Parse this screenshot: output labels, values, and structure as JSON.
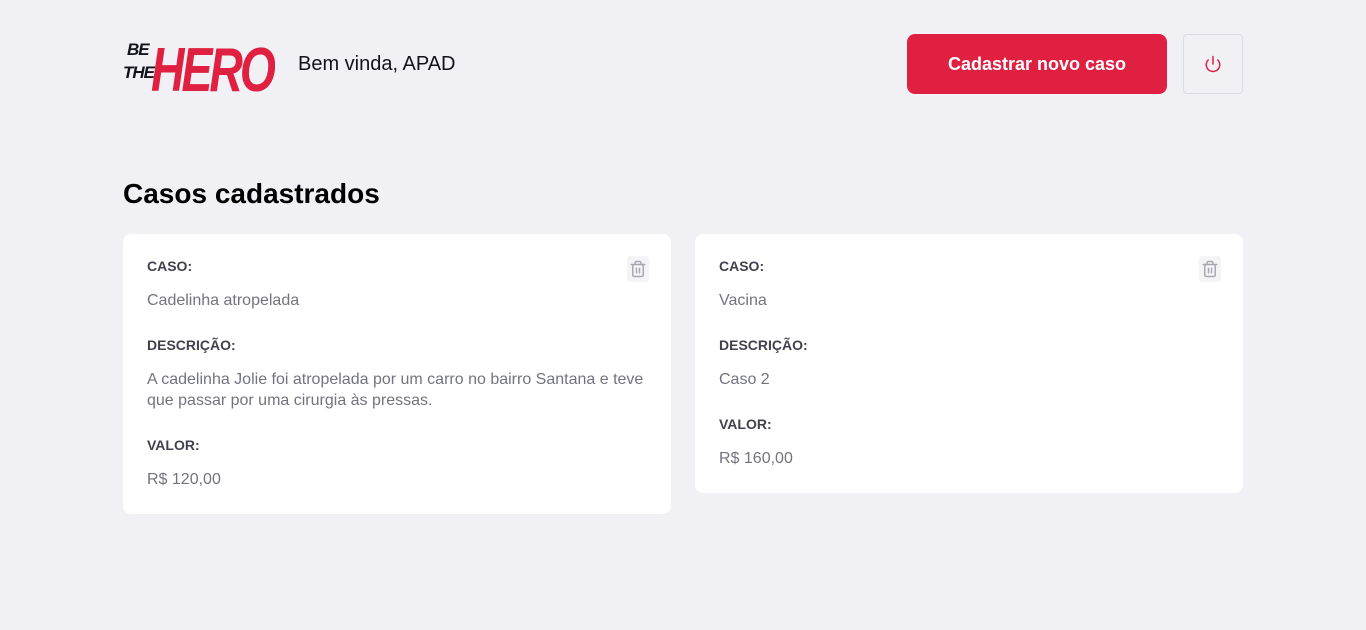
{
  "header": {
    "logo_text_top": "BE",
    "logo_text_middle": "THE",
    "logo_text_main": "HERO",
    "welcome": "Bem vinda, APAD",
    "new_case_label": "Cadastrar novo caso",
    "logout_icon": "power-icon"
  },
  "main": {
    "title": "Casos cadastrados",
    "cases": [
      {
        "case_label": "CASO:",
        "case_value": "Cadelinha atropelada",
        "description_label": "DESCRIÇÃO:",
        "description_value": "A cadelinha Jolie foi atropelada por um carro no bairro Santana e teve que passar por uma cirurgia às pressas.",
        "value_label": "VALOR:",
        "value_value": "R$ 120,00",
        "delete_icon": "trash-icon"
      },
      {
        "case_label": "CASO:",
        "case_value": "Vacina",
        "description_label": "DESCRIÇÃO:",
        "description_value": "Caso 2",
        "value_label": "VALOR:",
        "value_value": "R$ 160,00",
        "delete_icon": "trash-icon"
      }
    ]
  },
  "colors": {
    "background": "#f0f0f5",
    "accent": "#e02041",
    "card": "#ffffff",
    "label": "#41414d",
    "muted": "#737380"
  }
}
